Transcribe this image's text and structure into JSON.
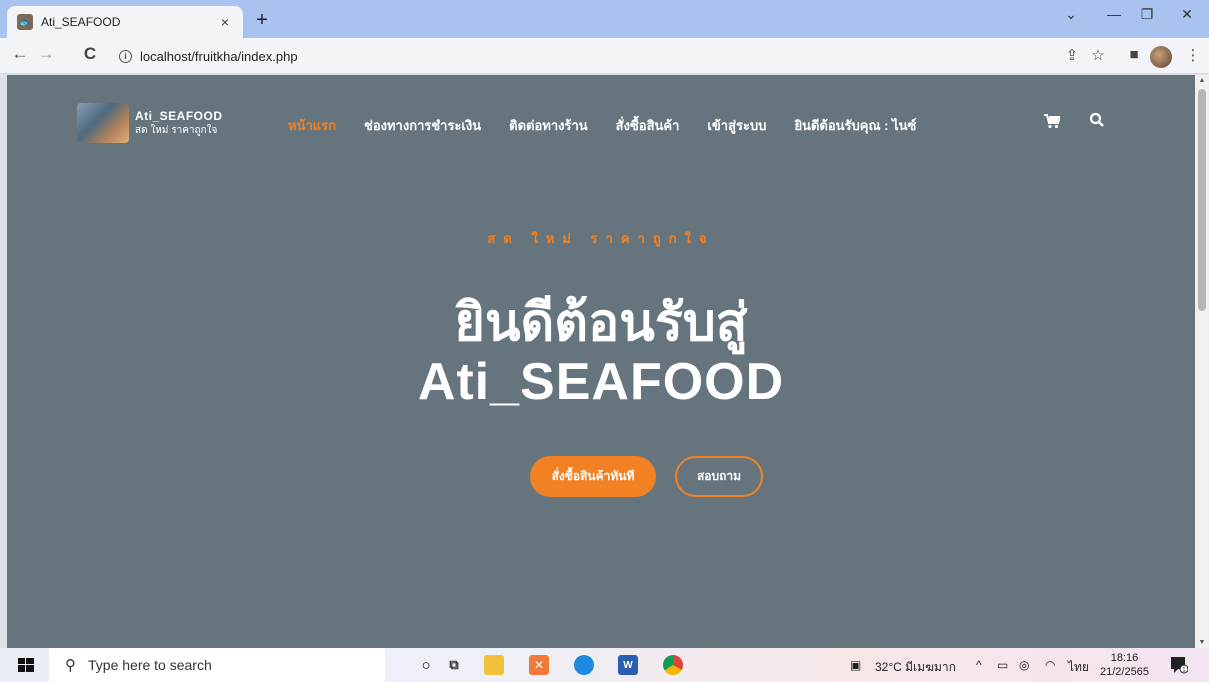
{
  "browser": {
    "tab_title": "Ati_SEAFOOD",
    "tab_close": "×",
    "new_tab": "+",
    "url": "localhost/fruitkha/index.php"
  },
  "site": {
    "logo_title": "Ati_SEAFOOD",
    "logo_subtitle": "สด ใหม่ ราคาถูกใจ",
    "nav": [
      {
        "label": "หน้าแรก",
        "active": true
      },
      {
        "label": "ช่องทางการชำระเงิน",
        "active": false
      },
      {
        "label": "ติดต่อทางร้าน",
        "active": false
      },
      {
        "label": "สั่งซื้อสินค้า",
        "active": false
      },
      {
        "label": "เข้าสู่ระบบ",
        "active": false
      },
      {
        "label": "ยินดีต้อนรับคุณ : ไนซ์",
        "active": false
      }
    ],
    "tagline": "สด ใหม่ ราคาถูกใจ",
    "hero_line1": "ยินดีต้อนรับสู่",
    "hero_line2": "Ati_SEAFOOD",
    "btn_order": "สั่งซื้อสินค้าทันที",
    "btn_inquiry": "สอบถาม",
    "accent_color": "#f28123",
    "background_color": "#66757d"
  },
  "taskbar": {
    "search_placeholder": "Type here to search",
    "weather": "32°C มีเมฆมาก",
    "language": "ไทย",
    "time": "18:16",
    "date": "21/2/2565"
  }
}
